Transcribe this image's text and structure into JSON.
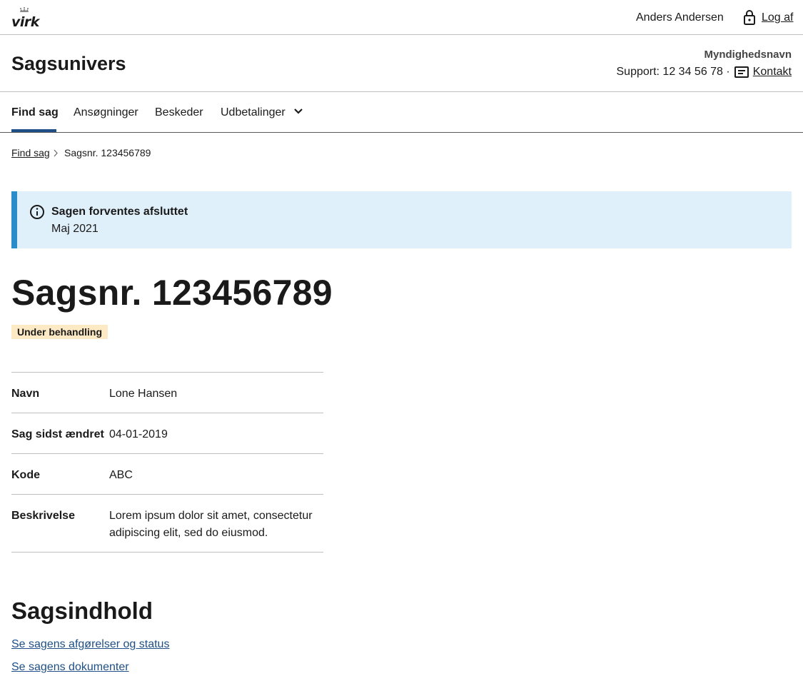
{
  "topbar": {
    "logo_text": "virk",
    "user_name": "Anders Andersen",
    "logout_label": "Log af"
  },
  "header": {
    "app_title": "Sagsunivers",
    "authority_name": "Myndighedsnavn",
    "support_text": "Support: 12 34 56 78 ·",
    "contact_label": "Kontakt"
  },
  "nav": {
    "items": [
      {
        "label": "Find sag",
        "active": true
      },
      {
        "label": "Ansøgninger"
      },
      {
        "label": "Beskeder"
      },
      {
        "label": "Udbetalinger",
        "has_dropdown": true
      }
    ]
  },
  "breadcrumb": {
    "parent_label": "Find sag",
    "current_label": "Sagsnr. 123456789"
  },
  "alert": {
    "title": "Sagen forventes afsluttet",
    "body": "Maj 2021"
  },
  "case": {
    "title": "Sagsnr. 123456789",
    "status": "Under behandling",
    "status_color": "#fde9c4"
  },
  "details": [
    {
      "label": "Navn",
      "value": "Lone Hansen"
    },
    {
      "label": "Sag sidst ændret",
      "value": "04-01-2019"
    },
    {
      "label": "Kode",
      "value": "ABC"
    },
    {
      "label": "Beskrivelse",
      "value": "Lorem ipsum dolor sit amet, consectetur adipiscing elit, sed do eiusmod."
    }
  ],
  "content": {
    "title": "Sagsindhold",
    "links": [
      "Se sagens afgørelser og status",
      "Se sagens dokumenter"
    ]
  },
  "colors": {
    "accent": "#1e4f86",
    "alert_bg": "#e0f0fa",
    "alert_border": "#2b8ccc"
  }
}
